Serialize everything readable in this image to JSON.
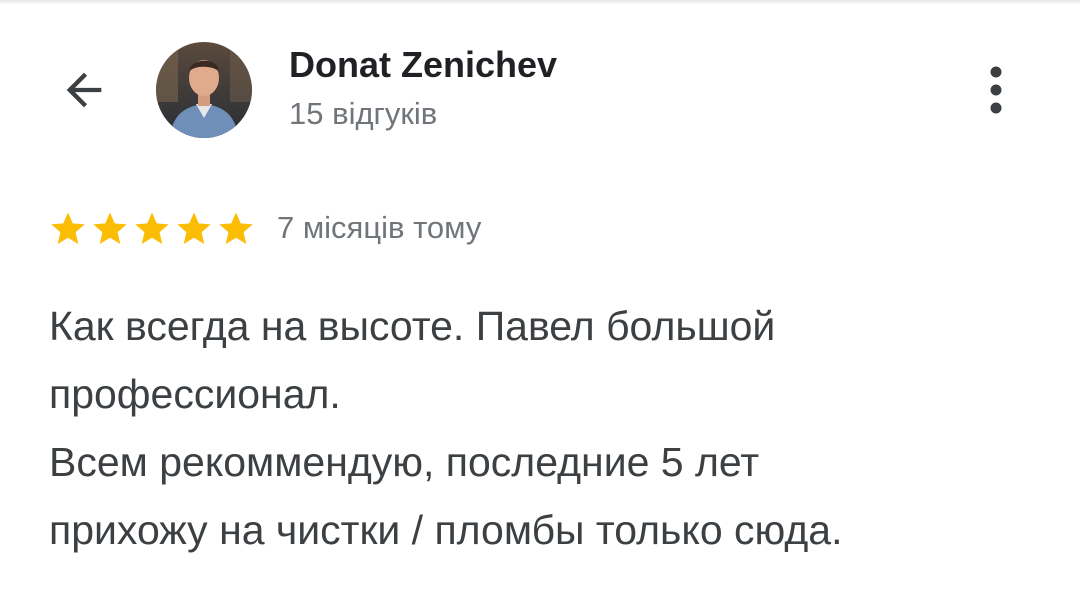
{
  "header": {
    "back_icon": "arrow-left-icon",
    "avatar_icon": "user-photo",
    "author_name": "Donat Zenichev",
    "review_count": "15 відгуків",
    "more_icon": "more-vertical-icon"
  },
  "review": {
    "rating": 5,
    "rating_max": 5,
    "star_color": "#fbbc04",
    "time": "7 місяців тому",
    "lines": [
      "Как всегда на высоте. Павел большой",
      "профессионал.",
      "Всем рекоммендую, последние 5 лет",
      "прихожу на чистки / пломбы только сюда."
    ]
  },
  "colors": {
    "primary_text": "#202124",
    "secondary_text": "#70757a",
    "body_text": "#3c4043"
  }
}
